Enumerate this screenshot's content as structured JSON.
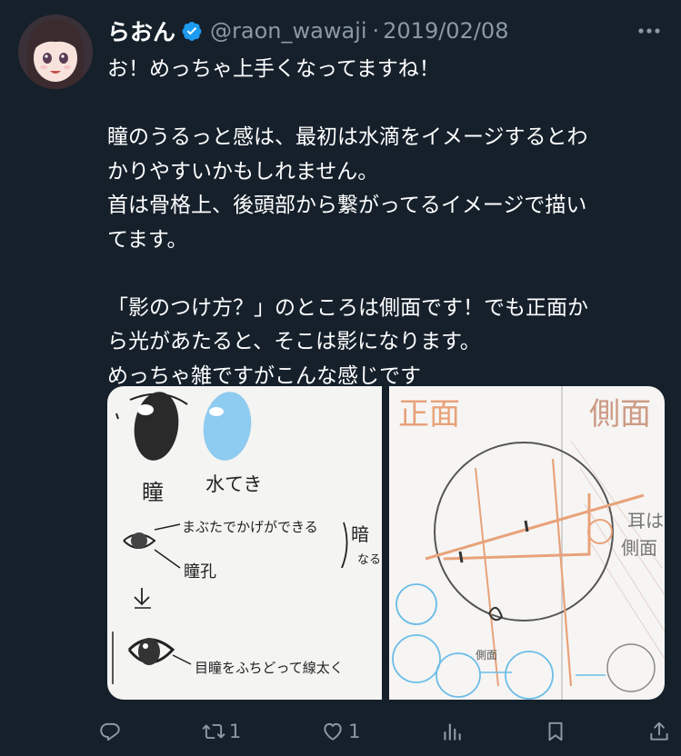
{
  "tweet": {
    "author_name": "らおん",
    "handle": "@raon_wawaji",
    "separator": "·",
    "date": "2019/02/08",
    "lines": [
      "お！めっちゃ上手くなってますね！",
      "",
      "瞳のうるっと感は、最初は水滴をイメージするとわ\nかりやすいかもしれません。",
      "首は骨格上、後頭部から繋がってるイメージで描い\nてます。",
      "",
      "「影のつけ方？」のところは側面です！でも正面か\nら光があたると、そこは影になります。",
      "めっちゃ雑ですがこんな感じです"
    ]
  },
  "images": {
    "left": {
      "labels": {
        "pupil": "瞳",
        "droplet": "水てき",
        "eyelid_note": "まぶたでかげができる",
        "dark": "暗",
        "naru": "なる",
        "iris": "瞳孔",
        "outline_note": "目瞳をふちどって線太く"
      }
    },
    "right": {
      "labels": {
        "front": "正面",
        "side": "側面",
        "side_small": "側面",
        "ear_note": "耳は",
        "side_face": "側面"
      }
    }
  },
  "actions": {
    "reply": {
      "icon": "reply-icon"
    },
    "retweet": {
      "icon": "retweet-icon",
      "count": "1"
    },
    "like": {
      "icon": "heart-icon",
      "count": "1"
    },
    "views": {
      "icon": "analytics-icon"
    },
    "bookmark": {
      "icon": "bookmark-icon"
    },
    "share": {
      "icon": "share-icon"
    }
  },
  "colors": {
    "background": "#15202b",
    "text": "#ffffff",
    "muted": "#8b98a5",
    "verified": "#1d9bf0",
    "droplet": "#8ecbf0",
    "sketch_orange": "#e8a27a"
  }
}
